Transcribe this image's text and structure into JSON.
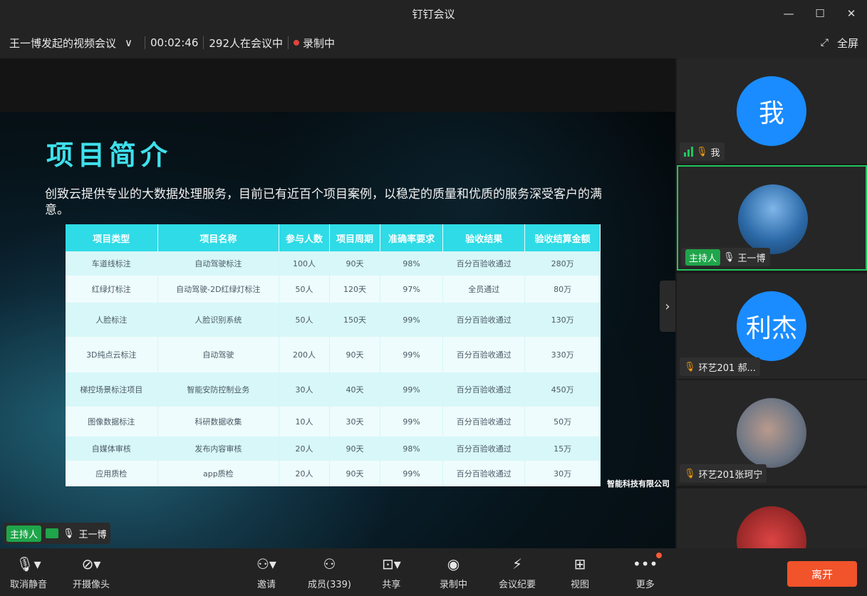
{
  "window": {
    "title": "钉钉会议",
    "minimize": "—",
    "maximize": "☐",
    "close": "✕"
  },
  "meeting": {
    "name": "王一博发起的视频会议",
    "chevron": "∨",
    "duration": "00:02:46",
    "participants": "292人在会议中",
    "recording": "录制中",
    "fullscreen": "全屏"
  },
  "slide": {
    "title": "项目简介",
    "intro": "创致云提供专业的大数据处理服务，目前已有近百个项目案例，以稳定的质量和优质的服务深受客户的满意。",
    "company": "智能科技有限公司",
    "headers": [
      "项目类型",
      "项目名称",
      "参与人数",
      "项目周期",
      "准确率要求",
      "验收结果",
      "验收结算金额"
    ],
    "rows": [
      [
        "车道线标注",
        "自动驾驶标注",
        "100人",
        "90天",
        "98%",
        "百分百验收通过",
        "280万"
      ],
      [
        "红绿灯标注",
        "自动驾驶-2D红绿灯标注",
        "50人",
        "120天",
        "97%",
        "全员通过",
        "80万"
      ],
      [
        "人脸标注",
        "人脸识别系统",
        "50人",
        "150天",
        "99%",
        "百分百验收通过",
        "130万"
      ],
      [
        "3D纯点云标注",
        "自动驾驶",
        "200人",
        "90天",
        "99%",
        "百分百验收通过",
        "330万"
      ],
      [
        "梯控场景标注项目",
        "智能安防控制业务",
        "30人",
        "40天",
        "99%",
        "百分百验收通过",
        "450万"
      ],
      [
        "图像数据标注",
        "科研数据收集",
        "10人",
        "30天",
        "99%",
        "百分百验收通过",
        "50万"
      ],
      [
        "自媒体审核",
        "发布内容审核",
        "20人",
        "90天",
        "98%",
        "百分百验收通过",
        "15万"
      ],
      [
        "应用质检",
        "app质检",
        "20人",
        "90天",
        "99%",
        "百分百验收通过",
        "30万"
      ]
    ]
  },
  "presenter": {
    "tag": "主持人",
    "name": "王一博"
  },
  "participants": [
    {
      "avatar_text": "我",
      "name": "我"
    },
    {
      "tag": "主持人",
      "name": "王一博"
    },
    {
      "avatar_text": "利杰",
      "name": "环艺201 郝..."
    },
    {
      "name": "环艺201张珂宁"
    }
  ],
  "toolbar": {
    "unmute": "取消静音",
    "camera": "开摄像头",
    "invite": "邀请",
    "members": "成员(339)",
    "share": "共享",
    "record": "录制中",
    "minutes": "会议纪要",
    "view": "视图",
    "more": "更多",
    "leave": "离开"
  },
  "colors": {
    "accent": "#21c55d",
    "leave": "#f1532b",
    "avatar": "#1a8cff",
    "table_header": "#2fdbe6"
  }
}
